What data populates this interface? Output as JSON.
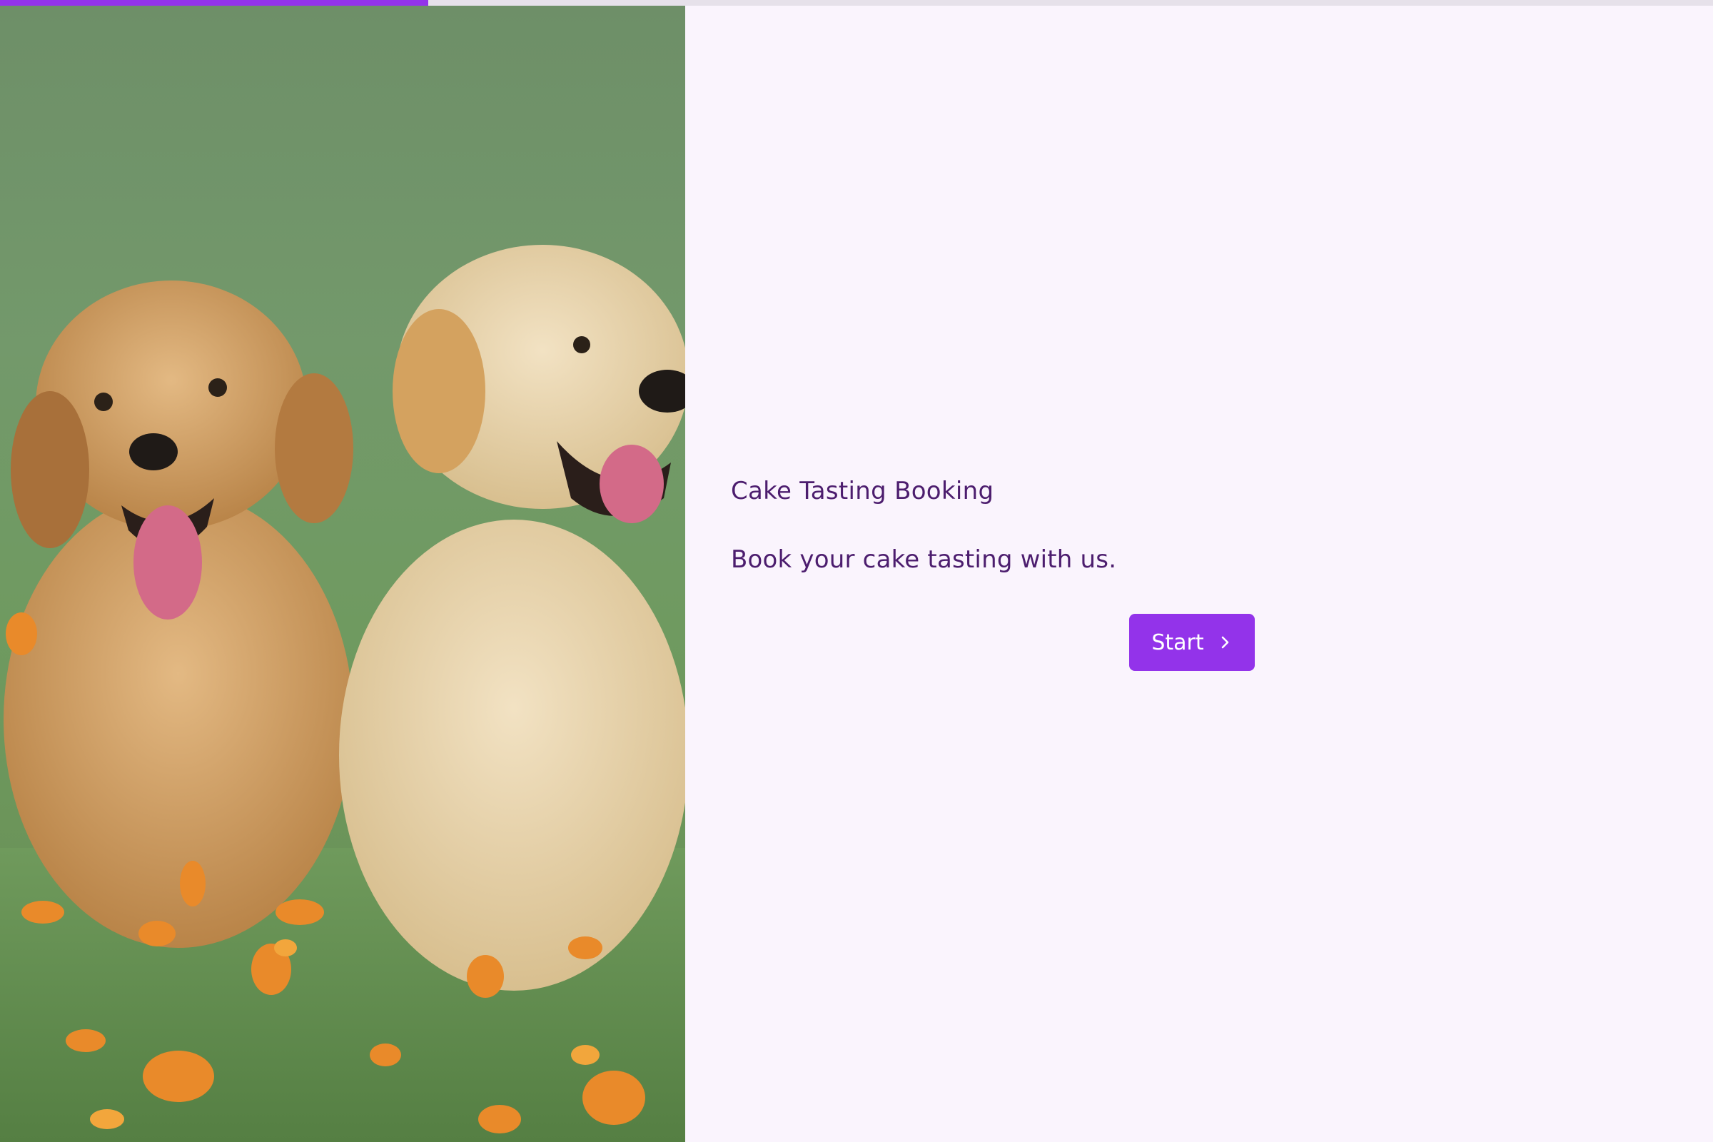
{
  "progress": {
    "value": 0.25,
    "color": "#9333ea"
  },
  "hero": {
    "image_icon": "puppies-photo"
  },
  "form": {
    "title": "Cake Tasting Booking",
    "description": "Book your cake tasting with us.",
    "start_label": "Start",
    "start_icon": "chevron-right-icon",
    "accent_color": "#9333ea",
    "text_color": "#4c1d6e",
    "background_color": "#faf4fd"
  }
}
